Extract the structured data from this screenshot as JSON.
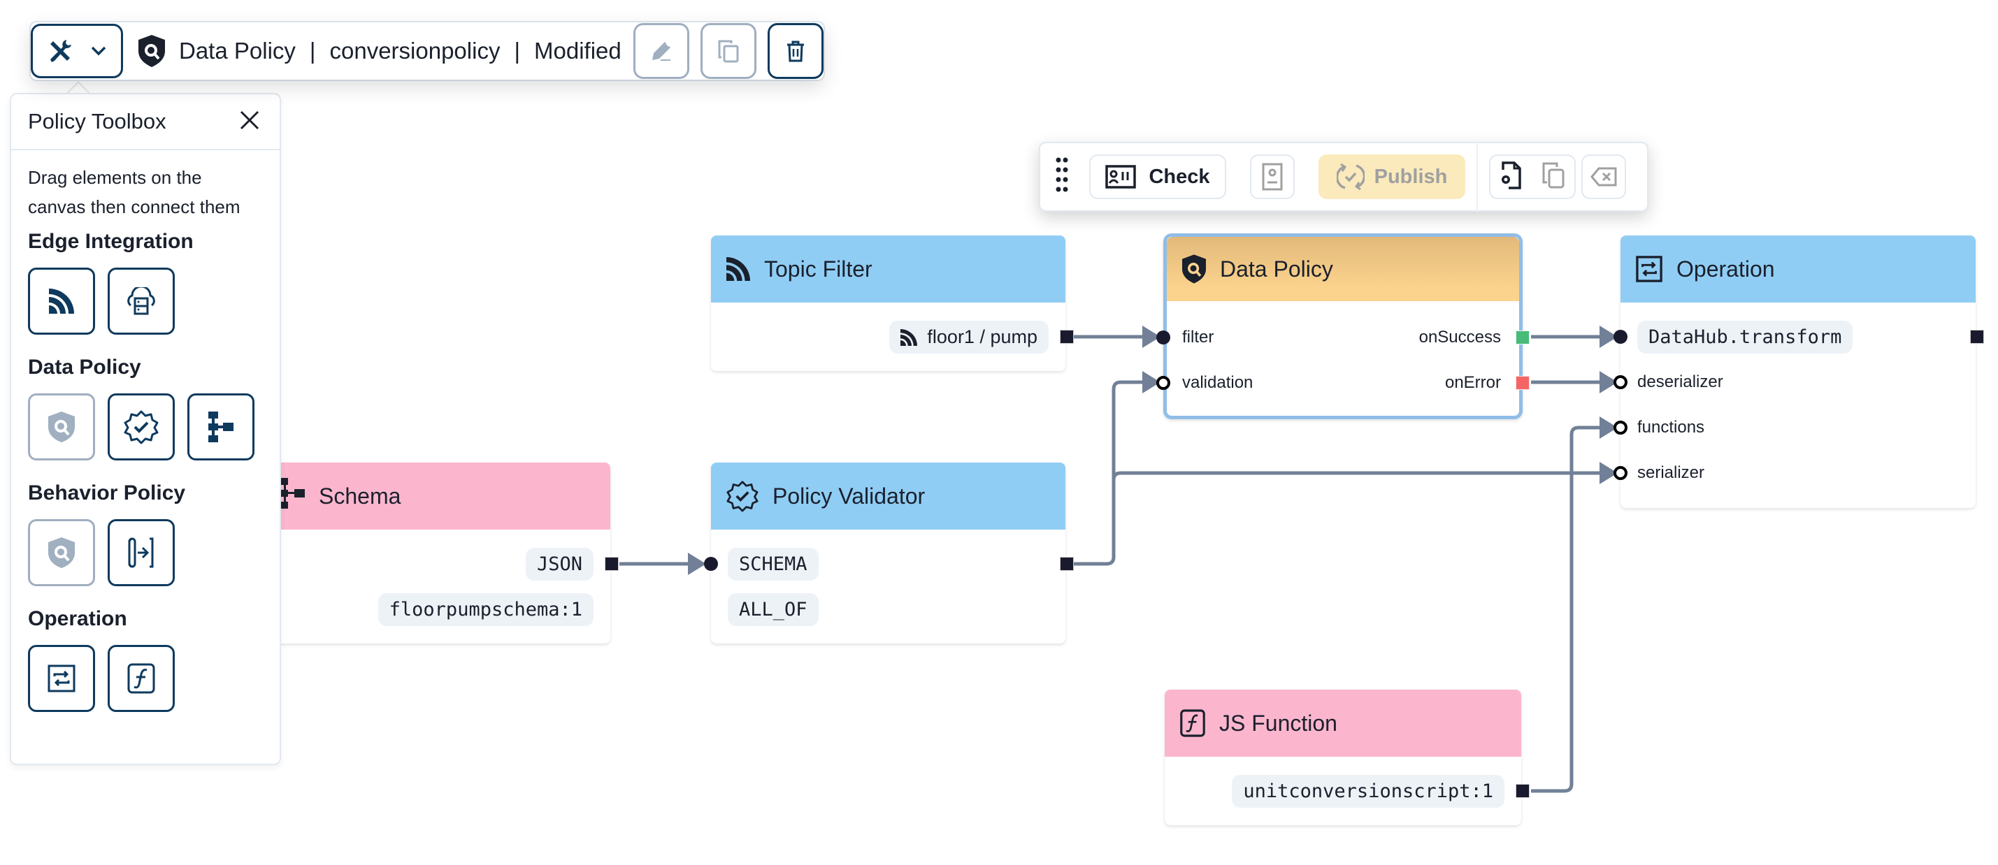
{
  "top_toolbar": {
    "title_type": "Data Policy",
    "title_name": "conversionpolicy",
    "title_status": "Modified",
    "separator": "|",
    "toolbox_toggle_icon": "tools-icon",
    "chevron_icon": "chevron-down-icon",
    "policy_icon": "shield-search-icon",
    "edit_icon": "pencil-icon",
    "duplicate_icon": "copy-icon",
    "delete_icon": "trash-icon"
  },
  "toolbox": {
    "title": "Policy Toolbox",
    "close_icon": "close-icon",
    "description": "Drag elements on the canvas then connect them",
    "sections": [
      {
        "title": "Edge Integration",
        "items": [
          {
            "icon": "topic-filter-icon",
            "enabled": true
          },
          {
            "icon": "client-filter-icon",
            "enabled": true
          }
        ]
      },
      {
        "title": "Data Policy",
        "items": [
          {
            "icon": "data-policy-icon",
            "enabled": false
          },
          {
            "icon": "validator-icon",
            "enabled": true
          },
          {
            "icon": "schema-icon",
            "enabled": true
          }
        ]
      },
      {
        "title": "Behavior Policy",
        "items": [
          {
            "icon": "behavior-policy-icon",
            "enabled": false
          },
          {
            "icon": "transition-icon",
            "enabled": true
          }
        ]
      },
      {
        "title": "Operation",
        "items": [
          {
            "icon": "operation-icon",
            "enabled": true
          },
          {
            "icon": "function-icon",
            "enabled": true
          }
        ]
      }
    ]
  },
  "floating_toolbar": {
    "drag_icon": "drag-handle-icon",
    "check_label": "Check",
    "check_icon": "id-card-icon",
    "report_icon": "report-icon",
    "publish_label": "Publish",
    "publish_icon": "publish-sync-icon",
    "settings_file_icon": "file-settings-icon",
    "copy_icon": "copy-icon",
    "clear_icon": "backspace-icon"
  },
  "nodes": {
    "topic_filter": {
      "title": "Topic Filter",
      "topic": "floor1 / pump"
    },
    "data_policy": {
      "title": "Data Policy",
      "inputs": [
        "filter",
        "validation"
      ],
      "outputs": [
        "onSuccess",
        "onError"
      ]
    },
    "operation": {
      "title": "Operation",
      "function": "DataHub.transform",
      "inputs": [
        "deserializer",
        "functions",
        "serializer"
      ]
    },
    "schema": {
      "title": "Schema",
      "type": "JSON",
      "version": "floorpumpschema:1"
    },
    "validator": {
      "title": "Policy Validator",
      "type": "SCHEMA",
      "strategy": "ALL_OF"
    },
    "js_function": {
      "title": "JS Function",
      "script": "unitconversionscript:1"
    }
  },
  "colors": {
    "primary": "#0e3a5e",
    "edge": "#718096",
    "success": "#48bb78",
    "error": "#f56565",
    "node_blue": "#90cdf4",
    "node_pink": "#fbb6ce",
    "node_orange": "#fbd38d",
    "publish_bg": "#faeabc"
  }
}
